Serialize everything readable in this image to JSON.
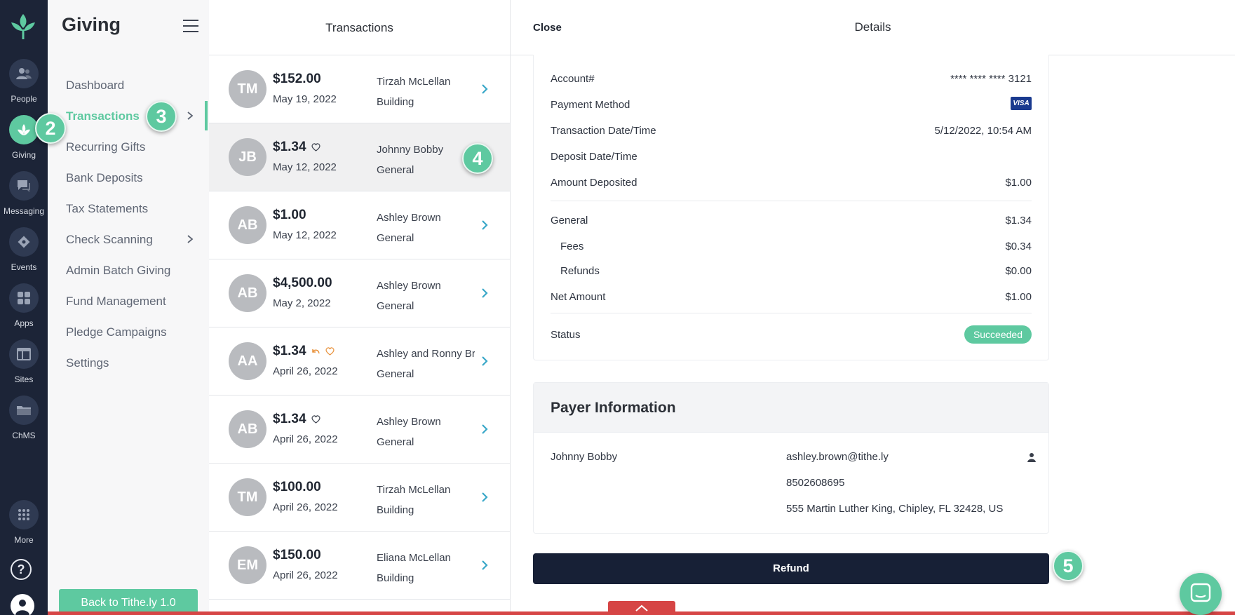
{
  "rail": {
    "items": [
      {
        "label": "People"
      },
      {
        "label": "Giving"
      },
      {
        "label": "Messaging"
      },
      {
        "label": "Events"
      },
      {
        "label": "Apps"
      },
      {
        "label": "Sites"
      },
      {
        "label": "ChMS"
      },
      {
        "label": "More"
      }
    ],
    "help": "?"
  },
  "menu": {
    "title": "Giving",
    "items": [
      {
        "label": "Dashboard"
      },
      {
        "label": "Transactions"
      },
      {
        "label": "Recurring Gifts"
      },
      {
        "label": "Bank Deposits"
      },
      {
        "label": "Tax Statements"
      },
      {
        "label": "Check Scanning"
      },
      {
        "label": "Admin Batch Giving"
      },
      {
        "label": "Fund Management"
      },
      {
        "label": "Pledge Campaigns"
      },
      {
        "label": "Settings"
      }
    ],
    "back_button": "Back to Tithe.ly 1.0"
  },
  "list": {
    "title": "Transactions",
    "rows": [
      {
        "initials": "TM",
        "amount": "$152.00",
        "date": "May 19, 2022",
        "name": "Tirzah McLellan",
        "fund": "Building"
      },
      {
        "initials": "JB",
        "amount": "$1.34",
        "date": "May 12, 2022",
        "name": "Johnny Bobby",
        "fund": "General"
      },
      {
        "initials": "AB",
        "amount": "$1.00",
        "date": "May 12, 2022",
        "name": "Ashley Brown",
        "fund": "General"
      },
      {
        "initials": "AB",
        "amount": "$4,500.00",
        "date": "May 2, 2022",
        "name": "Ashley Brown",
        "fund": "General"
      },
      {
        "initials": "AA",
        "amount": "$1.34",
        "date": "April 26, 2022",
        "name": "Ashley and Ronny Brown",
        "fund": "General"
      },
      {
        "initials": "AB",
        "amount": "$1.34",
        "date": "April 26, 2022",
        "name": "Ashley Brown",
        "fund": "General"
      },
      {
        "initials": "TM",
        "amount": "$100.00",
        "date": "April 26, 2022",
        "name": "Tirzah McLellan",
        "fund": "Building"
      },
      {
        "initials": "EM",
        "amount": "$150.00",
        "date": "April 26, 2022",
        "name": "Eliana McLellan",
        "fund": "Building"
      }
    ]
  },
  "detail": {
    "close": "Close",
    "title": "Details",
    "fields": {
      "account_label": "Account#",
      "account_value": "**** **** **** 3121",
      "payment_label": "Payment Method",
      "payment_value": "VISA",
      "txn_date_label": "Transaction Date/Time",
      "txn_date_value": "5/12/2022, 10:54 AM",
      "deposit_date_label": "Deposit Date/Time",
      "amount_deposited_label": "Amount Deposited",
      "amount_deposited_value": "$1.00",
      "general_label": "General",
      "general_value": "$1.34",
      "fees_label": "Fees",
      "fees_value": "$0.34",
      "refunds_label": "Refunds",
      "refunds_value": "$0.00",
      "net_label": "Net Amount",
      "net_value": "$1.00",
      "status_label": "Status",
      "status_value": "Succeeded"
    },
    "payer": {
      "title": "Payer Information",
      "name": "Johnny Bobby",
      "email": "ashley.brown@tithe.ly",
      "phone": "8502608695",
      "address": "555 Martin Luther King, Chipley, FL 32428, US"
    },
    "refund_button": "Refund"
  },
  "steps": {
    "s2": "2",
    "s3": "3",
    "s4": "4",
    "s5": "5"
  },
  "colors": {
    "accent": "#5ec9a0",
    "rail": "#1c2437",
    "refund": "#172036",
    "alert": "#d64545"
  }
}
